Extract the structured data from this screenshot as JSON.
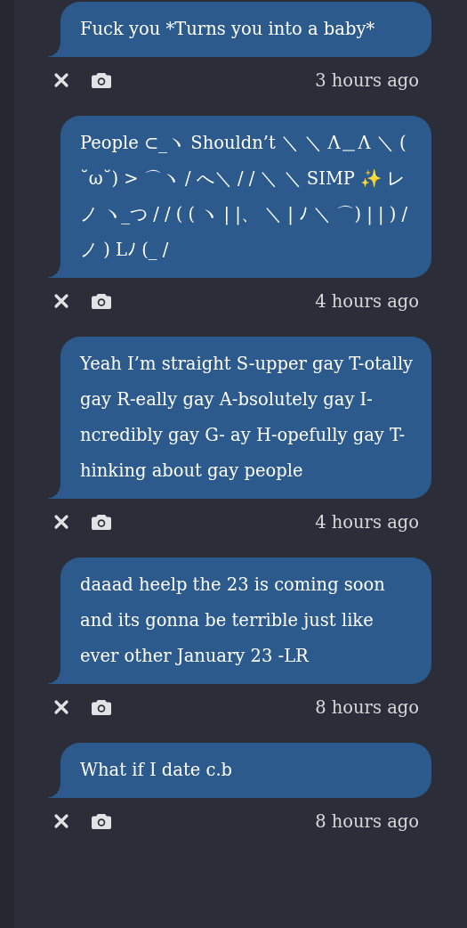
{
  "messages": [
    {
      "text": "Fuck you *Turns you into a baby*",
      "time": "3 hours ago"
    },
    {
      "text": "People ⊂_ヽ Shouldn’t ＼ ＼ Λ＿Λ ＼ ( ˘ω˘) > ⌒ヽ / へ＼ / / ＼ ＼ SIMP ✨ レノ ヽ_つ / / ( ( ヽ | |、 ＼ | ﾉ ＼ ⌒) | | ) / ノ ) Lﾉ (_ /",
      "time": "4 hours ago"
    },
    {
      "text": "Yeah I’m straight S-upper gay T-otally gay R-eally gay A-bsolutely gay I- ncredibly gay G- ay H-opefully gay T- hinking about gay people",
      "time": "4 hours ago"
    },
    {
      "text": "daaad heelp the 23 is coming soon and its gonna be terrible just like ever other January 23 -LR",
      "time": "8 hours ago"
    },
    {
      "text": "What if I date c.b",
      "time": "8 hours ago"
    }
  ]
}
